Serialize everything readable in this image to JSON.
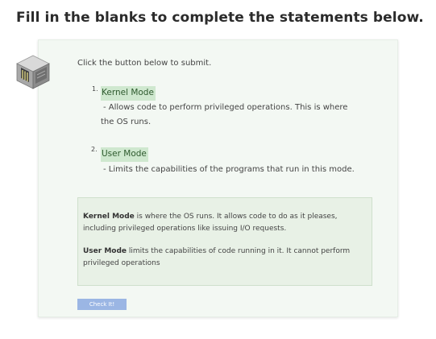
{
  "page_title": "Fill in the blanks to complete the statements below.",
  "instruction": "Click the button below to submit.",
  "statements": [
    {
      "number": "1.",
      "blank_value": "Kernel Mode",
      "description_line1": "- Allows code to perform privileged operations. This is where",
      "description_line2": "the OS runs."
    },
    {
      "number": "2.",
      "blank_value": "User Mode",
      "description_line1": "- Limits the capabilities of the programs that run in this mode."
    }
  ],
  "info": {
    "kernel_term": "Kernel Mode",
    "kernel_text_line1": " is where the OS runs. It allows code to do as it pleases,",
    "kernel_text_line2": "including privileged operations like issuing I/O requests.",
    "user_term": "User Mode",
    "user_text_line1": " limits the capabilities of code running in it. It cannot perform",
    "user_text_line2": "privileged operations"
  },
  "submit_button_label": "Check It!",
  "icons": {
    "exercise_icon": "server-rack-cube-icon"
  },
  "colors": {
    "card_background": "#f3f8f3",
    "blank_highlight": "#cfe8cf",
    "info_background": "#e8f1e6",
    "button_background": "#9bb6e4"
  }
}
